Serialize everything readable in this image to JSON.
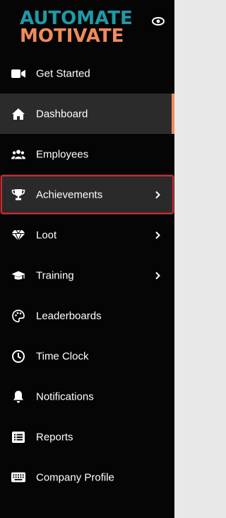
{
  "brand": {
    "line1": "AUTOMATE",
    "line2": "MOTIVATE",
    "color_primary": "#1e9aa8",
    "color_secondary": "#f08a5d"
  },
  "header": {
    "visibility_icon": "eye-icon"
  },
  "nav": {
    "items": [
      {
        "label": "Get Started",
        "icon": "video-camera-icon",
        "has_submenu": false,
        "state": "normal"
      },
      {
        "label": "Dashboard",
        "icon": "home-icon",
        "has_submenu": false,
        "state": "active"
      },
      {
        "label": "Employees",
        "icon": "users-icon",
        "has_submenu": false,
        "state": "normal"
      },
      {
        "label": "Achievements",
        "icon": "trophy-icon",
        "has_submenu": true,
        "state": "highlighted"
      },
      {
        "label": "Loot",
        "icon": "diamond-icon",
        "has_submenu": true,
        "state": "normal"
      },
      {
        "label": "Training",
        "icon": "graduation-cap-icon",
        "has_submenu": true,
        "state": "normal"
      },
      {
        "label": "Leaderboards",
        "icon": "palette-icon",
        "has_submenu": false,
        "state": "normal"
      },
      {
        "label": "Time Clock",
        "icon": "clock-icon",
        "has_submenu": false,
        "state": "normal"
      },
      {
        "label": "Notifications",
        "icon": "bell-icon",
        "has_submenu": false,
        "state": "normal"
      },
      {
        "label": "Reports",
        "icon": "list-icon",
        "has_submenu": false,
        "state": "normal"
      },
      {
        "label": "Company Profile",
        "icon": "keyboard-icon",
        "has_submenu": false,
        "state": "normal"
      }
    ]
  },
  "colors": {
    "sidebar_bg": "#050505",
    "active_bg": "#2b2b2b",
    "active_accent": "#f08a5d",
    "highlight_border": "#d7262b"
  }
}
